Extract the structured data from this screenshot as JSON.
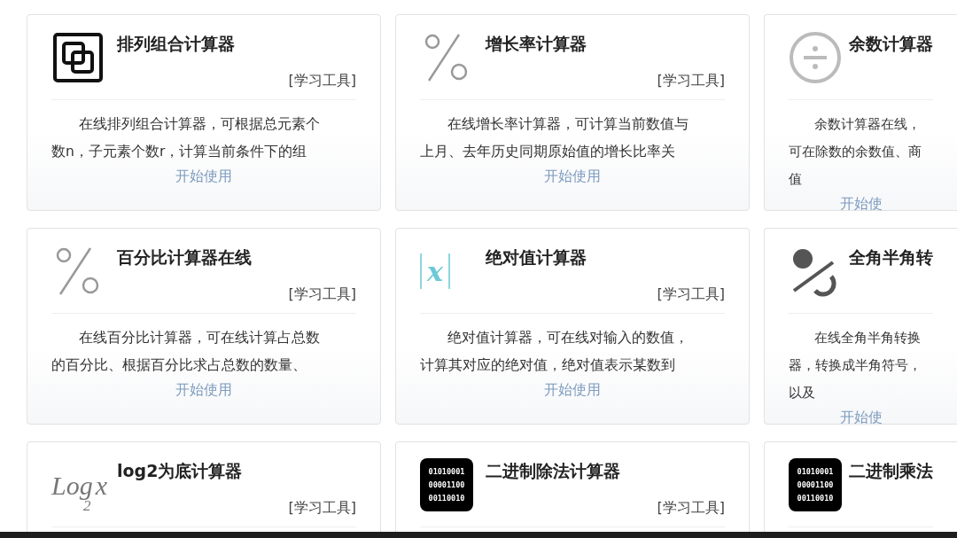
{
  "cards": [
    {
      "kind": "overlap-squares",
      "title": "排列组合计算器",
      "tag": "[学习工具]",
      "description": "在线排列组合计算器，可根据总元素个数n，子元素个数r，计算当前条件下的组",
      "action": "开始使用"
    },
    {
      "kind": "percent",
      "title": "增长率计算器",
      "tag": "[学习工具]",
      "description": "在线增长率计算器，可计算当前数值与上月、去年历史同期原始值的增长比率关",
      "action": "开始使用"
    },
    {
      "kind": "divide",
      "title": "余数计算器",
      "description": "余数计算器在线，可在除数的余数值、商值",
      "action": "开始使"
    },
    {
      "kind": "percent",
      "title": "百分比计算器在线",
      "tag": "[学习工具]",
      "description": "在线百分比计算器，可在线计算占总数的百分比、根据百分比求占总数的数量、",
      "action": "开始使用"
    },
    {
      "kind": "abs",
      "icon_text": [
        "x"
      ],
      "title": "绝对值计算器",
      "tag": "[学习工具]",
      "description": "绝对值计算器，可在线对输入的数值，计算其对应的绝对值，绝对值表示某数到",
      "action": "开始使用"
    },
    {
      "kind": "halfwidth",
      "title": "全角半角转",
      "description": "在线全角半角转换器，转换成半角符号，以及",
      "action": "开始使"
    },
    {
      "kind": "log",
      "icon_text": [
        "Log",
        "x",
        "2"
      ],
      "title": "log2为底计算器",
      "tag": "[学习工具]"
    },
    {
      "kind": "binary",
      "icon_text": [
        "01010001",
        "00001100",
        "00110010"
      ],
      "title": "二进制除法计算器",
      "tag": "[学习工具]"
    },
    {
      "kind": "binary",
      "icon_text": [
        "01010001",
        "00001100",
        "00110010"
      ],
      "title": "二进制乘法"
    }
  ]
}
